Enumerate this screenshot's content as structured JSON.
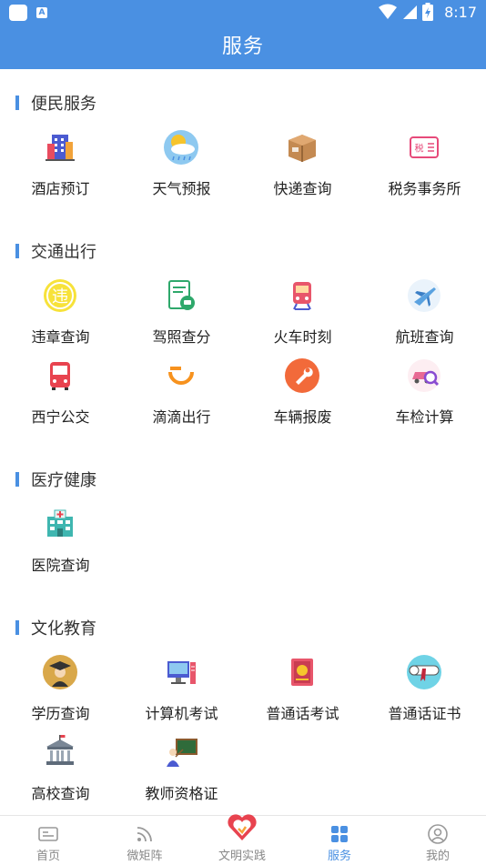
{
  "status_bar": {
    "time": "8:17",
    "notification_letter": "A"
  },
  "header": {
    "title": "服务"
  },
  "sections": [
    {
      "title": "便民服务",
      "items": [
        {
          "label": "酒店预订",
          "icon": "hotel-icon"
        },
        {
          "label": "天气预报",
          "icon": "weather-icon"
        },
        {
          "label": "快递查询",
          "icon": "package-icon"
        },
        {
          "label": "税务事务所",
          "icon": "tax-icon",
          "icon_text": "税"
        }
      ]
    },
    {
      "title": "交通出行",
      "items": [
        {
          "label": "违章查询",
          "icon": "violation-icon",
          "icon_text": "违"
        },
        {
          "label": "驾照查分",
          "icon": "license-icon"
        },
        {
          "label": "火车时刻",
          "icon": "train-icon"
        },
        {
          "label": "航班查询",
          "icon": "plane-icon"
        },
        {
          "label": "西宁公交",
          "icon": "bus-icon"
        },
        {
          "label": "滴滴出行",
          "icon": "didi-icon"
        },
        {
          "label": "车辆报废",
          "icon": "wrench-icon"
        },
        {
          "label": "车检计算",
          "icon": "car-inspect-icon"
        }
      ]
    },
    {
      "title": "医疗健康",
      "items": [
        {
          "label": "医院查询",
          "icon": "hospital-icon"
        }
      ]
    },
    {
      "title": "文化教育",
      "items": [
        {
          "label": "学历查询",
          "icon": "graduate-icon"
        },
        {
          "label": "计算机考试",
          "icon": "computer-icon"
        },
        {
          "label": "普通话考试",
          "icon": "book-icon"
        },
        {
          "label": "普通话证书",
          "icon": "certificate-icon"
        },
        {
          "label": "高校查询",
          "icon": "university-icon"
        },
        {
          "label": "教师资格证",
          "icon": "teacher-icon"
        }
      ]
    }
  ],
  "tabbar": {
    "tabs": [
      {
        "label": "首页",
        "icon": "home-icon",
        "active": false
      },
      {
        "label": "微矩阵",
        "icon": "rss-icon",
        "active": false
      },
      {
        "label": "文明实践",
        "icon": "heart-hand-icon",
        "active": false
      },
      {
        "label": "服务",
        "icon": "grid-icon",
        "active": true
      },
      {
        "label": "我的",
        "icon": "user-icon",
        "active": false
      }
    ]
  },
  "colors": {
    "primary": "#4a90e2",
    "active_tab": "#4a90e2",
    "inactive_tab": "#888888"
  }
}
